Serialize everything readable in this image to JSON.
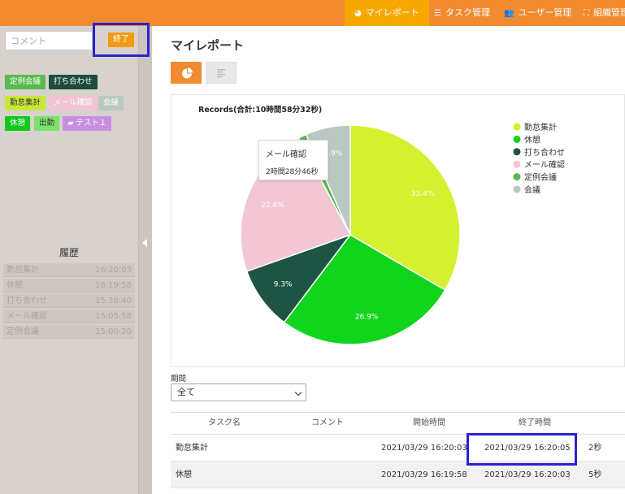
{
  "nav": {
    "items": [
      {
        "label": "マイレポート",
        "icon": "pie-chart-icon",
        "active": true
      },
      {
        "label": "タスク管理",
        "icon": "list-icon"
      },
      {
        "label": "ユーザー管理",
        "icon": "users-icon"
      },
      {
        "label": "組織管理",
        "icon": "sitemap-icon"
      }
    ]
  },
  "sidebar": {
    "comment_placeholder": "コメント",
    "end_label": "終了",
    "task_buttons": [
      {
        "label": "定例会議",
        "color": "#5ab94f"
      },
      {
        "label": "打ち合わせ",
        "color": "#1e4d3e"
      },
      {
        "label": "勤怠集計",
        "color": "#c8e838"
      },
      {
        "label": "メール確認",
        "color": "#f0c4d2"
      },
      {
        "label": "会議",
        "color": "#b9c9c1"
      },
      {
        "label": "休憩",
        "color": "#11c81c"
      },
      {
        "label": "出勤",
        "color": "#7ae36a"
      },
      {
        "label": "テスト１",
        "color": "#c98ee0"
      }
    ],
    "history_title": "履歴",
    "history": [
      {
        "name": "勤怠集計",
        "time": "16:20:03"
      },
      {
        "name": "休憩",
        "time": "16:19:58"
      },
      {
        "name": "打ち合わせ",
        "time": "15:38:40"
      },
      {
        "name": "メール確認",
        "time": "15:05:58"
      },
      {
        "name": "定例会議",
        "time": "15:00:20"
      }
    ]
  },
  "main": {
    "title": "マイレポート",
    "period_label": "期間",
    "period_value": "全て",
    "tooltip": {
      "title": "メール確認",
      "value": "2時間28分46秒"
    },
    "table": {
      "headers": [
        "タスク名",
        "コメント",
        "開始時間",
        "終了時間"
      ],
      "rows": [
        {
          "task": "勤怠集計",
          "comment": "",
          "start": "2021/03/29 16:20:03",
          "end": "2021/03/29 16:20:05",
          "duration": "2秒"
        },
        {
          "task": "休憩",
          "comment": "",
          "start": "2021/03/29 16:19:58",
          "end": "2021/03/29 16:20:03",
          "duration": "5秒"
        }
      ]
    }
  },
  "chart_data": {
    "type": "pie",
    "title": "Records(合計:10時間58分32秒)",
    "legend_position": "right",
    "slices": [
      {
        "label": "勤怠集計",
        "value": 33.4,
        "color": "#d4f02e",
        "text": "33.4%"
      },
      {
        "label": "休憩",
        "value": 26.9,
        "color": "#11d41c",
        "text": "26.9%"
      },
      {
        "label": "打ち合わせ",
        "value": 9.3,
        "color": "#1e5444",
        "text": "9.3%"
      },
      {
        "label": "メール確認",
        "value": 22.6,
        "color": "#f3c6d4",
        "text": "22.6%"
      },
      {
        "label": "定例会議",
        "value": 1.2,
        "color": "#5ab94f",
        "text": ""
      },
      {
        "label": "会議",
        "value": 6.6,
        "color": "#b9c9c1",
        "text": "6.9%"
      }
    ]
  }
}
